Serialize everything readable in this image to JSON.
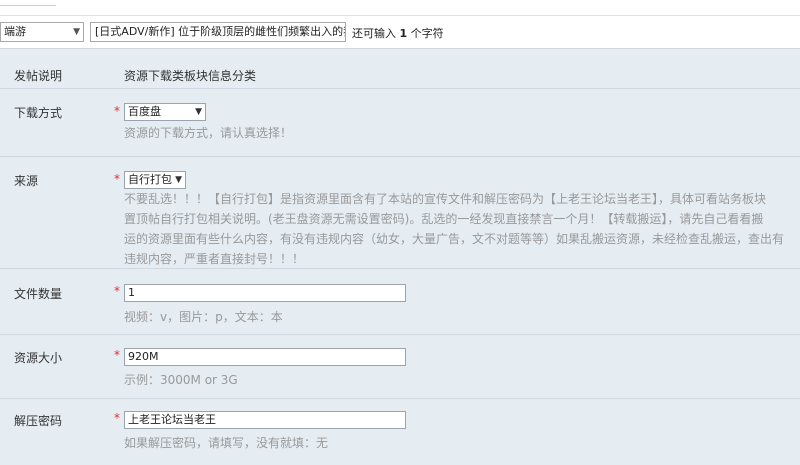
{
  "title_row": {
    "type_value": "端游",
    "title_value": "[日式ADV/新作] 位于阶级顶层的雌性们频繁出入的我AD",
    "remain_prefix": "还可输入",
    "remain_count": "1",
    "remain_suffix": "个字符"
  },
  "form": {
    "intro": {
      "label": "发帖说明",
      "text": "资源下载类板块信息分类"
    },
    "download_method": {
      "label": "下载方式",
      "required": "*",
      "value": "百度盘",
      "tip": "资源的下载方式，请认真选择！"
    },
    "source": {
      "label": "来源",
      "required": "*",
      "value": "自行打包",
      "tip_lines": [
        "不要乱选！！！【自行打包】是指资源里面含有了本站的宣传文件和解压密码为【上老王论坛当老王】，具体可看站务板块",
        "置顶帖自行打包相关说明。(老王盘资源无需设置密码)。乱选的一经发现直接禁言一个月！【转载搬运】，请先自己看看搬",
        "运的资源里面有些什么内容，有没有违规内容（幼女，大量广告，文不对题等等）如果乱搬运资源，未经检查乱搬运，查出有",
        "违规内容，严重者直接封号！！！"
      ]
    },
    "file_count": {
      "label": "文件数量",
      "required": "*",
      "value": "1",
      "tip": "视频：v，图片：p，文本：本"
    },
    "resource_size": {
      "label": "资源大小",
      "required": "*",
      "value": "920M",
      "tip": "示例：3000M or 3G"
    },
    "password": {
      "label": "解压密码",
      "required": "*",
      "value": "上老王论坛当老王",
      "tip": "如果解压密码，请填写，没有就填：无"
    }
  },
  "icons": {
    "dropdown": "chevron-down-icon"
  }
}
